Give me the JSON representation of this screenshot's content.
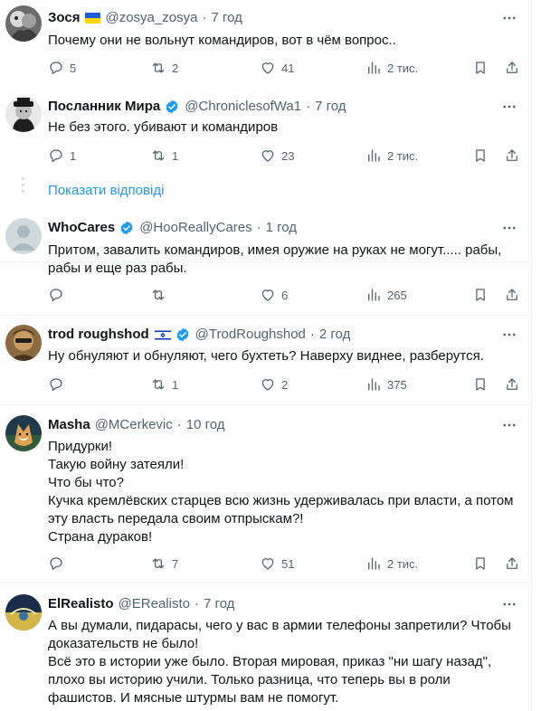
{
  "show_replies_label": "Показати відповіді",
  "posts": [
    {
      "name": "Зося",
      "flag": "ukraine",
      "handle": "@zosya_zosya",
      "time": "7 год",
      "lines": [
        "Почему они не вольнут командиров, вот в чём вопрос.."
      ],
      "replies": "5",
      "reposts": "2",
      "likes": "41",
      "views": "2 тис."
    },
    {
      "name": "Посланник Мира",
      "verified": true,
      "handle": "@ChroniclesofWa1",
      "time": "7 год",
      "lines": [
        "Не без этого.  убивают и командиров"
      ],
      "replies": "1",
      "reposts": "1",
      "likes": "23",
      "views": "2 тис."
    },
    {
      "name": "WhoCares",
      "verified": true,
      "handle": "@HooReallyCares",
      "time": "1 год",
      "lines": [
        "Притом, завалить командиров, имея оружие на руках не могут..... рабы,",
        "рабы и еще раз рабы."
      ],
      "replies": "",
      "reposts": "",
      "likes": "6",
      "views": "265"
    },
    {
      "name": "trod roughshod",
      "flag": "israel",
      "verified": true,
      "handle": "@TrodRoughshod",
      "time": "2 год",
      "lines": [
        "Ну обнуляют и обнуляют, чего бухтеть? Наверху виднее, разберутся."
      ],
      "replies": "",
      "reposts": "1",
      "likes": "2",
      "views": "375"
    },
    {
      "name": "Masha",
      "handle": "@MCerkevic",
      "time": "10 год",
      "lines": [
        "Придурки!",
        "Такую войну затеяли!",
        "Что бы что?",
        "Кучка кремлёвских старцев всю жизнь удерживалась при власти, а потом",
        "эту власть передала своим отпрыскам?!",
        "Страна дураков!"
      ],
      "replies": "",
      "reposts": "7",
      "likes": "51",
      "views": "2 тис."
    },
    {
      "name": "ElRealisto",
      "handle": "@ERealisto",
      "time": "7 год",
      "lines": [
        "А вы думали, пидарасы, чего у вас в армии телефоны запретили? Чтобы",
        "доказательств не было!",
        "Всё это в истории уже было. Вторая мировая, приказ \"ни шагу назад\",",
        "плохо вы историю учили. Только разница, что теперь вы в роли",
        "фашистов. И мясные штурмы вам не помогут."
      ]
    }
  ],
  "colors": {
    "text": "#0f1419",
    "secondary": "#536471",
    "link": "#1d9bf0",
    "verified": "#1d9bf0",
    "divider": "#eff3f4"
  },
  "icons": [
    "reply-icon",
    "repost-icon",
    "like-icon",
    "views-icon",
    "bookmark-icon",
    "share-icon",
    "more-icon",
    "verified-badge-icon"
  ]
}
